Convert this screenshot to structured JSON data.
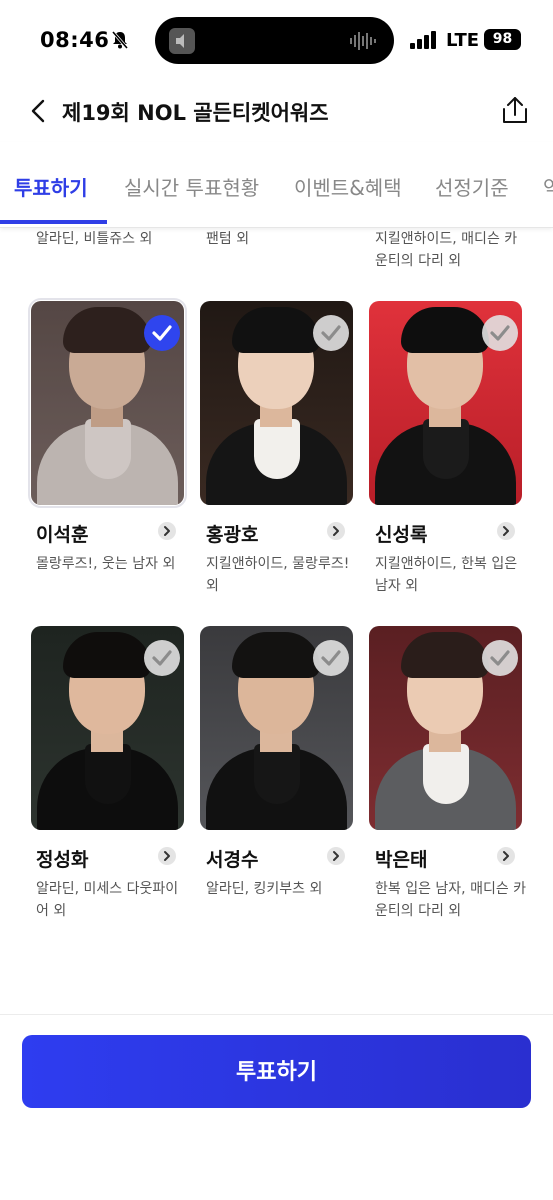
{
  "status_bar": {
    "time": "08:46",
    "network": "LTE",
    "battery": "98"
  },
  "header": {
    "title": "제19회 NOL 골든티켓어워즈"
  },
  "tabs": [
    {
      "label": "투표하기",
      "active": true
    },
    {
      "label": "실시간 투표현황",
      "active": false
    },
    {
      "label": "이벤트&혜택",
      "active": false
    },
    {
      "label": "선정기준",
      "active": false
    },
    {
      "label": "역",
      "active": false
    }
  ],
  "top_partial_row": [
    "알라딘, 비틀쥬스 외",
    "팬텀 외",
    "지킬앤하이드, 매디슨 카운티의 다리 외"
  ],
  "candidates": [
    {
      "name": "이석훈",
      "works": "몰랑루즈!, 웃는 남자 외",
      "selected": true
    },
    {
      "name": "홍광호",
      "works": "지킬앤하이드, 물랑루즈! 외",
      "selected": false
    },
    {
      "name": "신성록",
      "works": "지킬앤하이드, 한복 입은 남자 외",
      "selected": false
    },
    {
      "name": "정성화",
      "works": "알라딘, 미세스 다웃파이어 외",
      "selected": false
    },
    {
      "name": "서경수",
      "works": "알라딘, 킹키부츠 외",
      "selected": false
    },
    {
      "name": "박은태",
      "works": "한복 입은 남자, 매디슨 카운티의 다리 외",
      "selected": false
    }
  ],
  "vote_button": {
    "label": "투표하기"
  },
  "colors": {
    "accent": "#2f3ee6",
    "check_selected": "#2f45ee",
    "check_unselected": "#e1e1e1"
  }
}
